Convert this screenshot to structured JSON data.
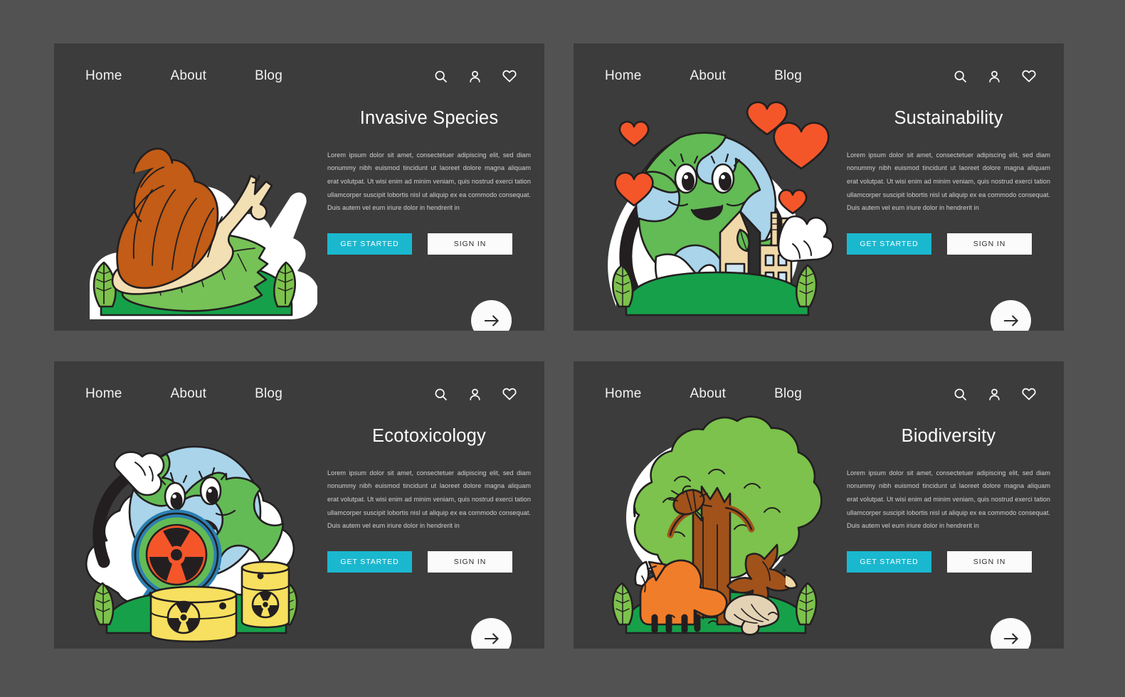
{
  "theme": {
    "page_background": "#525252",
    "card_background": "#3c3c3c",
    "accent": "#1ab8cf",
    "button_secondary": "#fbfbfb",
    "title_color": "#ffffff",
    "body_color": "#d2d2d2"
  },
  "nav": {
    "links": [
      {
        "label": "Home"
      },
      {
        "label": "About"
      },
      {
        "label": "Blog"
      }
    ],
    "icons": [
      {
        "name": "search-icon"
      },
      {
        "name": "user-icon"
      },
      {
        "name": "heart-icon"
      }
    ]
  },
  "common": {
    "body_text": "Lorem ipsum dolor sit amet, consectetuer adipiscing elit, sed diam nonummy nibh euismod tincidunt ut laoreet dolore magna aliquam erat volutpat. Ut wisi enim ad minim veniam, quis nostrud exerci tation ullamcorper suscipit lobortis nisl ut aliquip ex ea commodo consequat. Duis autem vel eum iriure dolor in hendrerit in",
    "primary_button": "GET STARTED",
    "secondary_button": "SIGN IN",
    "arrow_button": "arrow-right-icon"
  },
  "cards": [
    {
      "id": "invasive",
      "title": "Invasive Species",
      "illustration": "snail-on-leaf-illustration"
    },
    {
      "id": "sustain",
      "title": "Sustainability",
      "illustration": "earth-hugging-building-illustration"
    },
    {
      "id": "ecotox",
      "title": "Ecotoxicology",
      "illustration": "sad-earth-toxic-barrels-illustration"
    },
    {
      "id": "biodiversity",
      "title": "Biodiversity",
      "illustration": "tree-fox-bird-illustration"
    }
  ],
  "illustration_palette": {
    "outline": "#231f20",
    "sticker_white": "#ffffff",
    "grass_dark": "#17a04a",
    "leaf_light": "#7cc24c",
    "leaf_mid": "#5fb545",
    "shell_brown": "#c25c16",
    "snail_body": "#f2dfb3",
    "earth_ocean": "#a9d4ea",
    "earth_land": "#63bb55",
    "heart_orange": "#f4562a",
    "building_tan": "#f0d8a8",
    "barrel_yellow": "#f7e05f",
    "radiation_orange": "#f4562a",
    "magnifier_blue": "#2b7fb0",
    "tree_canopy": "#7cc24c",
    "trunk_brown": "#a1521a",
    "fox_orange": "#f07d2a",
    "mushroom_tan": "#e3d3b4"
  }
}
